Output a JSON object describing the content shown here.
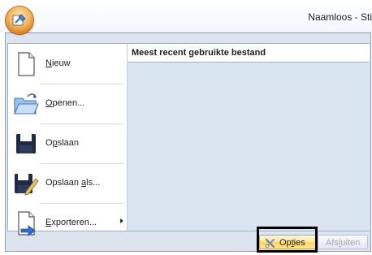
{
  "window": {
    "title": "Naamloos - Sti"
  },
  "menu": {
    "items": [
      {
        "pre": "",
        "u": "N",
        "post": "ieuw",
        "icon": "new-document-icon"
      },
      {
        "pre": "",
        "u": "O",
        "post": "penen...",
        "icon": "open-folder-icon"
      },
      {
        "pre": "O",
        "u": "p",
        "post": "slaan",
        "icon": "save-disk-icon"
      },
      {
        "pre": "Opslaan ",
        "u": "a",
        "post": "ls...",
        "icon": "save-as-icon"
      },
      {
        "pre": "",
        "u": "E",
        "post": "xporteren...",
        "icon": "export-icon"
      }
    ]
  },
  "recent": {
    "header": "Meest recent gebruikte bestand",
    "files": []
  },
  "footer": {
    "options": {
      "pre": "Op",
      "u": "t",
      "post": "ies"
    },
    "exit": {
      "pre": "Afs",
      "u": "l",
      "post": "uiten",
      "enabled": false
    }
  }
}
